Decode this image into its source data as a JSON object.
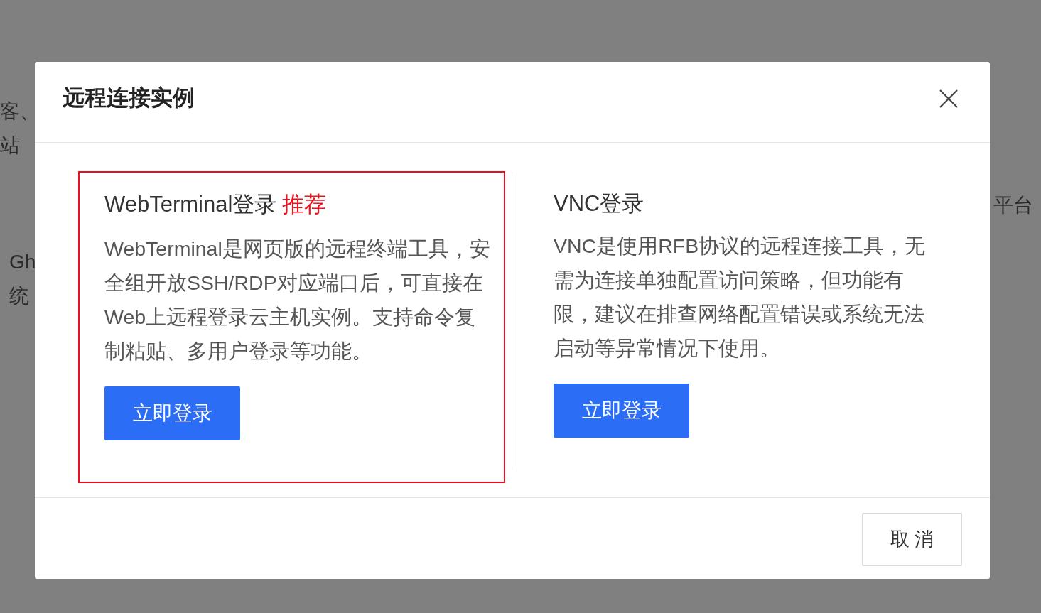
{
  "background": {
    "texts": [
      "客、",
      "站",
      "平台",
      "Gh",
      "统"
    ]
  },
  "modal": {
    "title": "远程连接实例",
    "options": [
      {
        "title": "WebTerminal登录",
        "tag": "推荐",
        "description": "WebTerminal是网页版的远程终端工具，安全组开放SSH/RDP对应端口后，可直接在Web上远程登录云主机实例。支持命令复制粘贴、多用户登录等功能。",
        "button": "立即登录",
        "highlighted": true
      },
      {
        "title": "VNC登录",
        "description": "VNC是使用RFB协议的远程连接工具，无需为连接单独配置访问策略，但功能有限，建议在排查网络配置错误或系统无法启动等异常情况下使用。",
        "button": "立即登录",
        "highlighted": false
      }
    ],
    "cancel": "取 消"
  }
}
